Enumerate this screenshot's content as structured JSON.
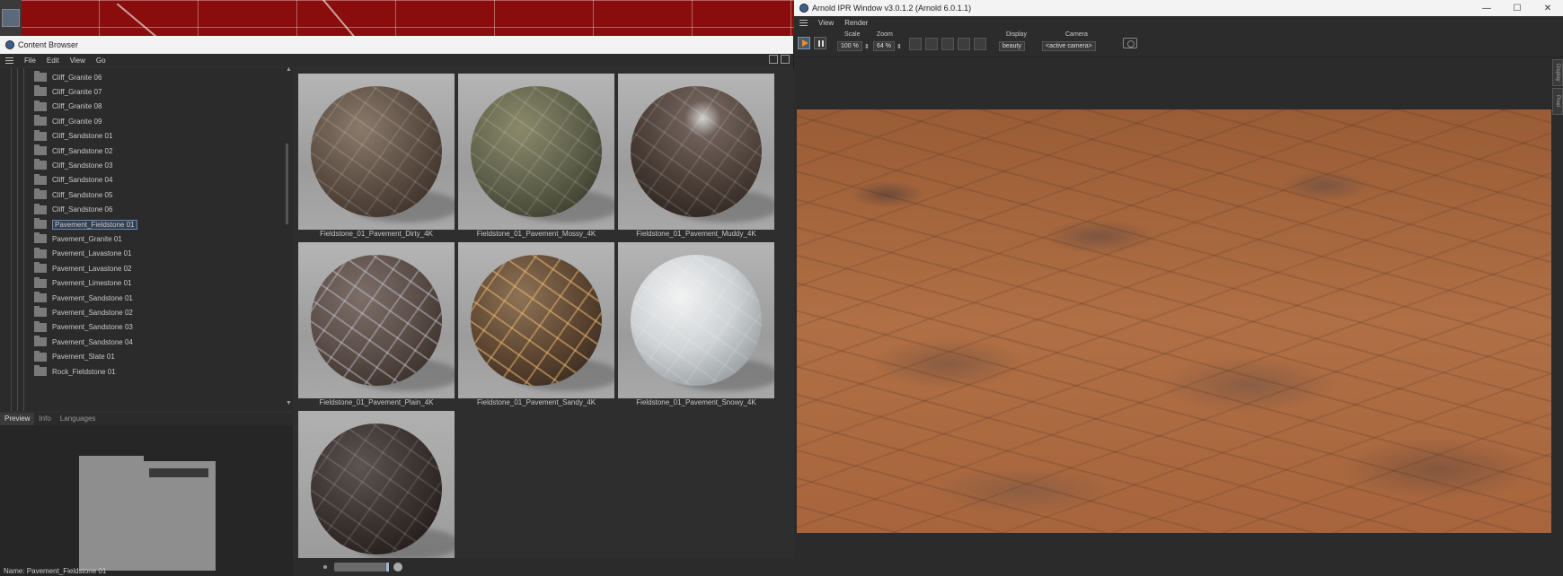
{
  "content_browser": {
    "title": "Content Browser",
    "menu": [
      "File",
      "Edit",
      "View",
      "Go"
    ],
    "tree_items": [
      "Cliff_Granite 06",
      "Cliff_Granite 07",
      "Cliff_Granite 08",
      "Cliff_Granite 09",
      "Cliff_Sandstone 01",
      "Cliff_Sandstone 02",
      "Cliff_Sandstone 03",
      "Cliff_Sandstone 04",
      "Cliff_Sandstone 05",
      "Cliff_Sandstone 06",
      "Pavement_Fieldstone 01",
      "Pavement_Granite 01",
      "Pavement_Lavastone 01",
      "Pavement_Lavastone 02",
      "Pavement_Limestone 01",
      "Pavement_Sandstone 01",
      "Pavement_Sandstone 02",
      "Pavement_Sandstone 03",
      "Pavement_Sandstone 04",
      "Pavement_Slate 01",
      "Rock_Fieldstone 01"
    ],
    "selected_index": 10,
    "preview_tabs": [
      "Preview",
      "Info",
      "Languages"
    ],
    "active_preview_tab": "Preview",
    "name_row": "Name:  Pavement_Fieldstone 01",
    "thumbnails": [
      "Fieldstone_01_Pavement_Dirty_4K",
      "Fieldstone_01_Pavement_Mossy_4K",
      "Fieldstone_01_Pavement_Muddy_4K",
      "Fieldstone_01_Pavement_Plain_4K",
      "Fieldstone_01_Pavement_Sandy_4K",
      "Fieldstone_01_Pavement_Snowy_4K",
      ""
    ]
  },
  "ipr": {
    "title": "Arnold IPR Window v3.0.1.2 (Arnold 6.0.1.1)",
    "menu": [
      "View",
      "Render"
    ],
    "scale_label": "Scale",
    "scale_value": "100 %",
    "zoom_label": "Zoom",
    "zoom_value": "64 %",
    "display_label": "Display",
    "display_value": "beauty",
    "camera_label": "Camera",
    "camera_value": "<active camera>",
    "side_tabs": [
      "Display",
      "Pixel"
    ],
    "window_controls": [
      "—",
      "☐",
      "✕"
    ]
  },
  "colors": {
    "accent": "#f08a2a",
    "selection": "#6a87b8",
    "viewport_red": "#8a0d0d"
  }
}
